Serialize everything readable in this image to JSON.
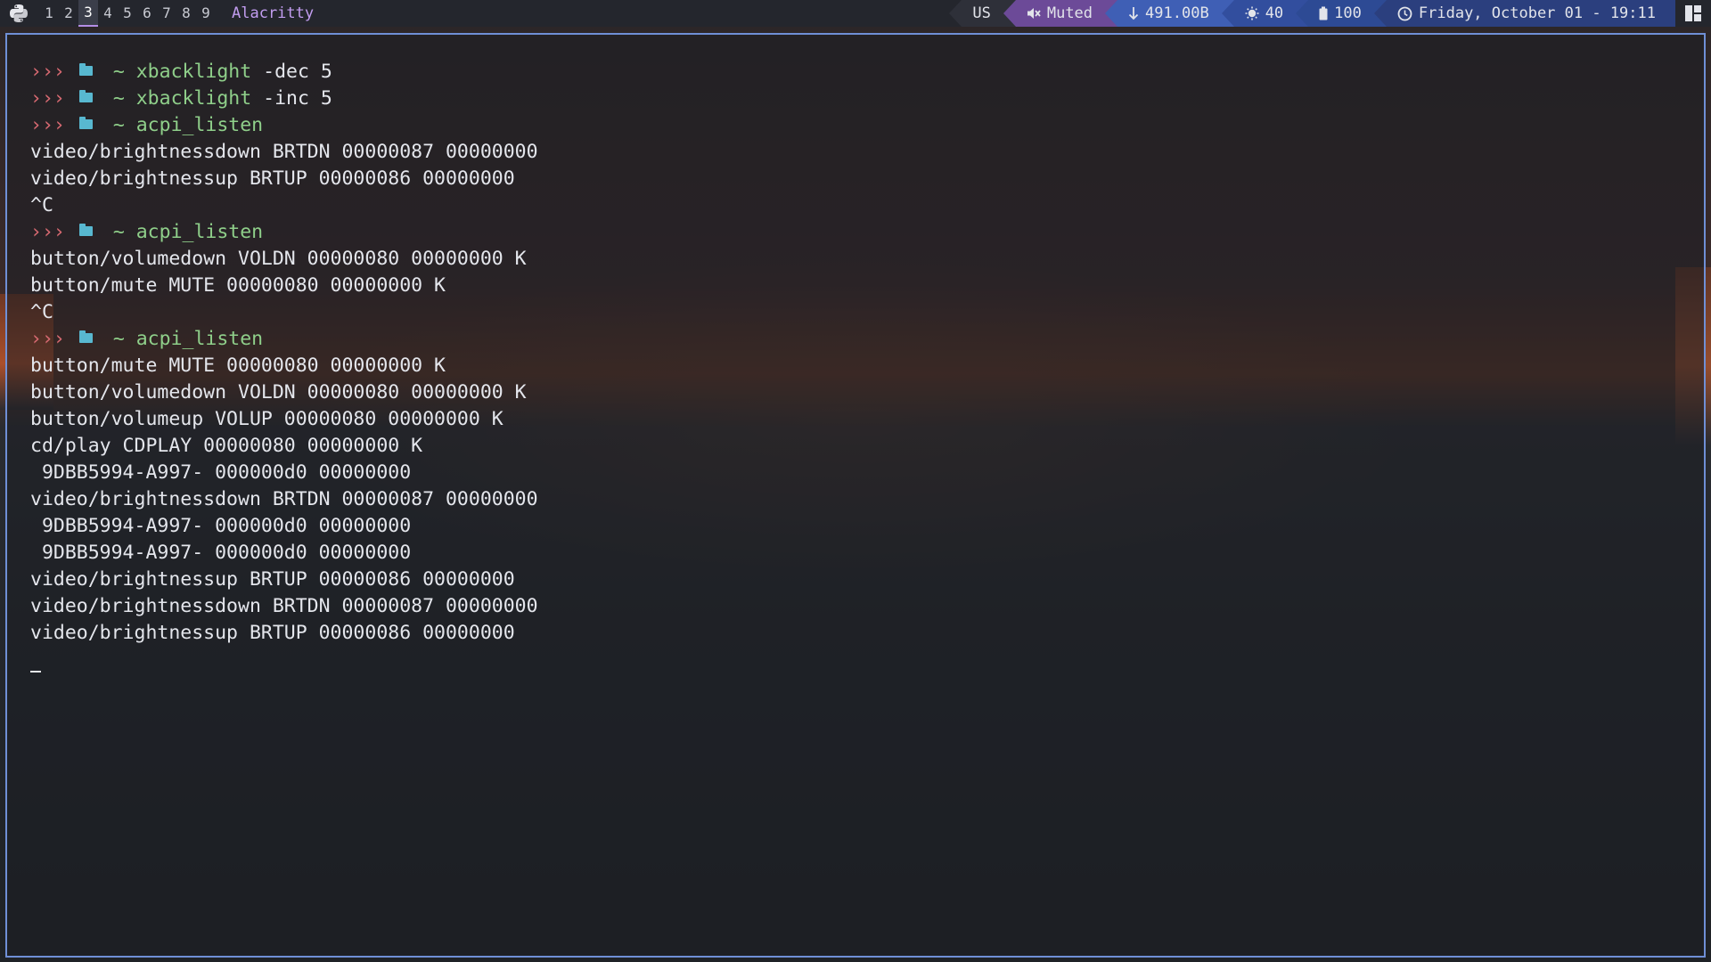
{
  "topbar": {
    "workspaces": [
      "1",
      "2",
      "3",
      "4",
      "5",
      "6",
      "7",
      "8",
      "9"
    ],
    "active_workspace": "3",
    "window_title": "Alacritty",
    "keyboard_layout": "US",
    "volume": "Muted",
    "network": "491.00B",
    "brightness": "40",
    "battery": "100",
    "datetime": "Friday, October 01 - 19:11"
  },
  "colors": {
    "accent": "#b48ee6",
    "border": "#6f8fd6",
    "prompt_arrows": "#d96a72",
    "prompt_cmd": "#8fcf8a",
    "folder": "#58b8d0"
  },
  "terminal": {
    "prompt_symbol": "›››",
    "prompt_dir": "~",
    "lines": [
      {
        "type": "prompt",
        "cmd": "xbacklight",
        "args": " -dec 5"
      },
      {
        "type": "prompt",
        "cmd": "xbacklight",
        "args": " -inc 5"
      },
      {
        "type": "prompt",
        "cmd": "acpi_listen",
        "args": ""
      },
      {
        "type": "out",
        "text": "video/brightnessdown BRTDN 00000087 00000000"
      },
      {
        "type": "out",
        "text": "video/brightnessup BRTUP 00000086 00000000"
      },
      {
        "type": "out",
        "text": "^C"
      },
      {
        "type": "prompt",
        "cmd": "acpi_listen",
        "args": ""
      },
      {
        "type": "out",
        "text": "button/volumedown VOLDN 00000080 00000000 K"
      },
      {
        "type": "out",
        "text": "button/mute MUTE 00000080 00000000 K"
      },
      {
        "type": "out",
        "text": "^C"
      },
      {
        "type": "prompt",
        "cmd": "acpi_listen",
        "args": ""
      },
      {
        "type": "out",
        "text": "button/mute MUTE 00000080 00000000 K"
      },
      {
        "type": "out",
        "text": "button/volumedown VOLDN 00000080 00000000 K"
      },
      {
        "type": "out",
        "text": "button/volumeup VOLUP 00000080 00000000 K"
      },
      {
        "type": "out",
        "text": "cd/play CDPLAY 00000080 00000000 K"
      },
      {
        "type": "out",
        "text": " 9DBB5994-A997- 000000d0 00000000"
      },
      {
        "type": "out",
        "text": "video/brightnessdown BRTDN 00000087 00000000"
      },
      {
        "type": "out",
        "text": " 9DBB5994-A997- 000000d0 00000000"
      },
      {
        "type": "out",
        "text": " 9DBB5994-A997- 000000d0 00000000"
      },
      {
        "type": "out",
        "text": "video/brightnessup BRTUP 00000086 00000000"
      },
      {
        "type": "out",
        "text": "video/brightnessdown BRTDN 00000087 00000000"
      },
      {
        "type": "out",
        "text": "video/brightnessup BRTUP 00000086 00000000"
      },
      {
        "type": "cursor"
      }
    ]
  }
}
